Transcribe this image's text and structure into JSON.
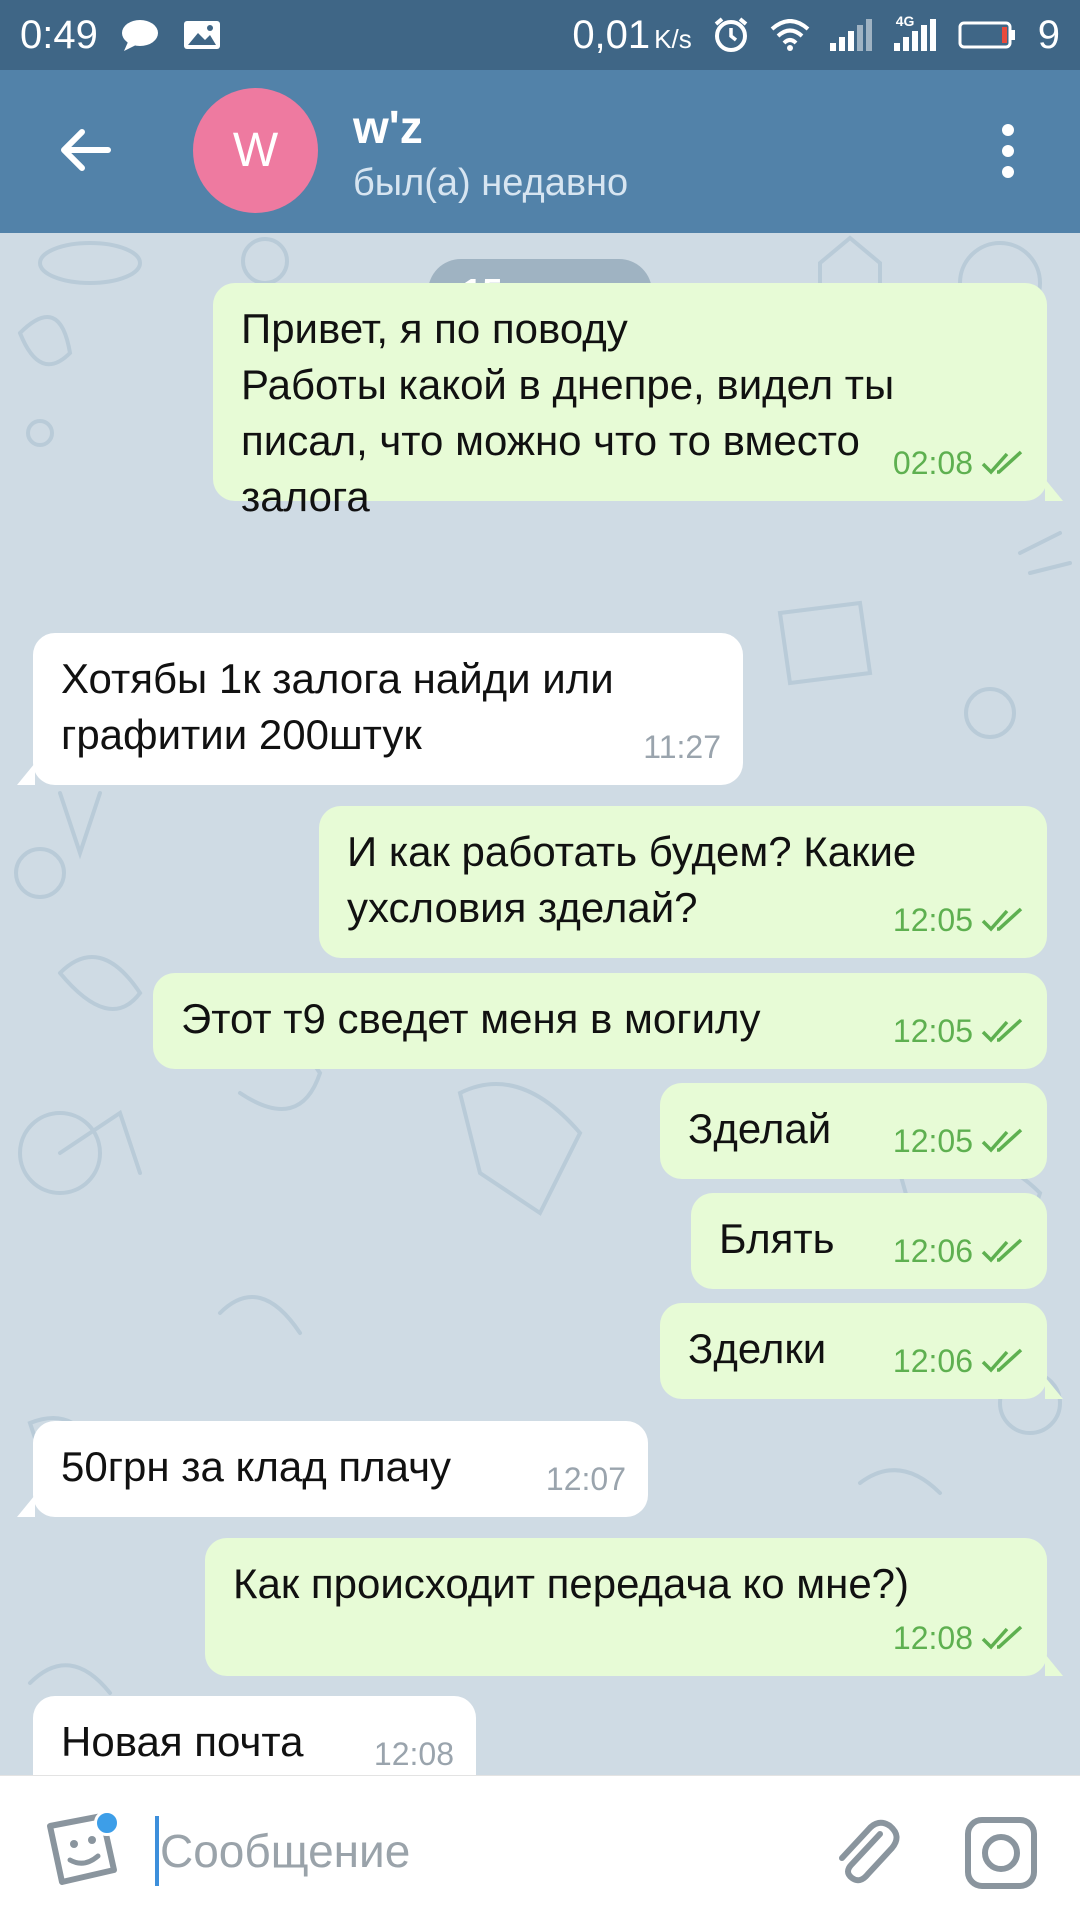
{
  "status_bar": {
    "time": "0:49",
    "speed_value": "0,01",
    "speed_unit": "K/s",
    "network_label": "4G",
    "battery_level": "9",
    "icons": [
      "chat-icon",
      "image-icon",
      "alarm-icon",
      "wifi-icon",
      "signal-icon",
      "signal-4g-icon",
      "battery-icon"
    ]
  },
  "header": {
    "avatar_letter": "W",
    "title": "w'z",
    "subtitle": "был(а) недавно",
    "avatar_color": "#ee7aa0",
    "bar_color": "#5282a9"
  },
  "chat": {
    "date": "15 марта",
    "messages": [
      {
        "dir": "out",
        "text": "Привет,  я по поводу\nРаботы какой в днепре,  видел ты\nписал,  что можно что то вместо\nзалога",
        "time": "02:08",
        "read": true
      },
      {
        "dir": "in",
        "text": "Хотябы 1к залога найди или\nграфитии 200штук",
        "time": "11:27"
      },
      {
        "dir": "out",
        "text": "И как работать будем? Какие\nухсловия зделай?",
        "time": "12:05",
        "read": true
      },
      {
        "dir": "out",
        "text": "Этот т9 сведет меня в могилу",
        "time": "12:05",
        "read": true
      },
      {
        "dir": "out",
        "text": "Зделай",
        "time": "12:05",
        "read": true
      },
      {
        "dir": "out",
        "text": "Блять",
        "time": "12:06",
        "read": true
      },
      {
        "dir": "out",
        "text": "Зделки",
        "time": "12:06",
        "read": true
      },
      {
        "dir": "in",
        "text": "50грн за клад плачу",
        "time": "12:07"
      },
      {
        "dir": "out",
        "text": "Как происходит передача ко мне?)",
        "time": "12:08",
        "read": true
      },
      {
        "dir": "in",
        "text": "Новая почта",
        "time": "12:08"
      }
    ]
  },
  "input": {
    "placeholder": "Сообщение",
    "value": ""
  },
  "colors": {
    "outgoing_bubble": "#e7fbd6",
    "incoming_bubble": "#ffffff",
    "read_check": "#5eb050",
    "chat_background": "#cfdbe4"
  }
}
